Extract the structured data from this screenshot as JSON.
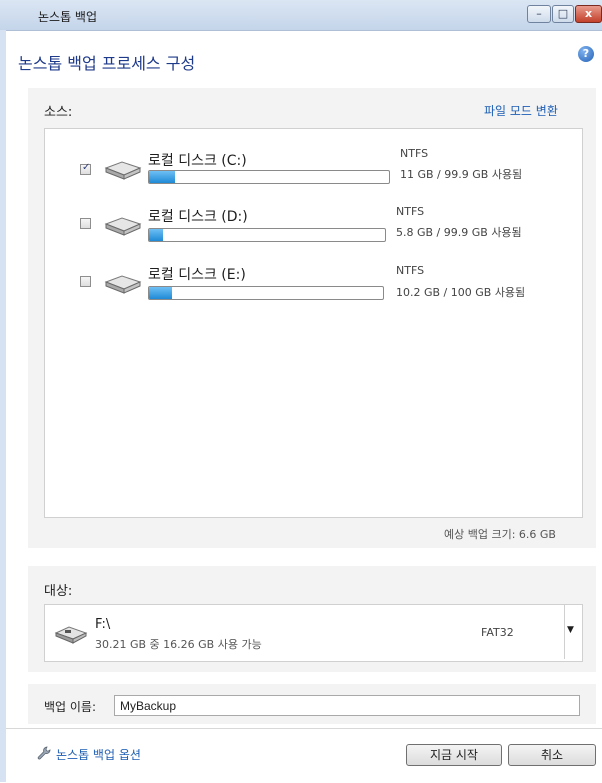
{
  "window": {
    "title": "논스톱 백업"
  },
  "header": {
    "title": "논스톱 백업 프로세스 구성",
    "help_icon": "?"
  },
  "source": {
    "label": "소스:",
    "switch_link": "파일 모드 변환",
    "drives": [
      {
        "name": "로컬 디스크 (C:)",
        "checked": true,
        "fs": "NTFS",
        "usage": "11 GB / 99.9 GB 사용됨",
        "fill": 0.11,
        "checkmark": "✓"
      },
      {
        "name": "로컬 디스크 (D:)",
        "checked": false,
        "fs": "NTFS",
        "usage": "5.8 GB / 99.9 GB 사용됨",
        "fill": 0.06,
        "checkmark": ""
      },
      {
        "name": "로컬 디스크 (E:)",
        "checked": false,
        "fs": "NTFS",
        "usage": "10.2 GB / 100 GB 사용됨",
        "fill": 0.1,
        "checkmark": ""
      }
    ],
    "estimate": "예상 백업 크기: 6.6 GB"
  },
  "target": {
    "label": "대상:",
    "drive": "F:\\",
    "free": "30.21 GB 중 16.26 GB 사용 가능",
    "fs": "FAT32",
    "dropdown_arrow": "▼"
  },
  "backup_name": {
    "label": "백업 이름:",
    "value": "MyBackup"
  },
  "footer": {
    "options_link": "논스톱 백업 옵션",
    "start_button": "지금 시작",
    "cancel_button": "취소"
  },
  "controls": {
    "minimize": "–",
    "maximize": "□",
    "close": "x"
  },
  "colors": {
    "accent": "#1e5fb4",
    "progress": "#1f8ad6",
    "panel": "#f3f3f3"
  }
}
